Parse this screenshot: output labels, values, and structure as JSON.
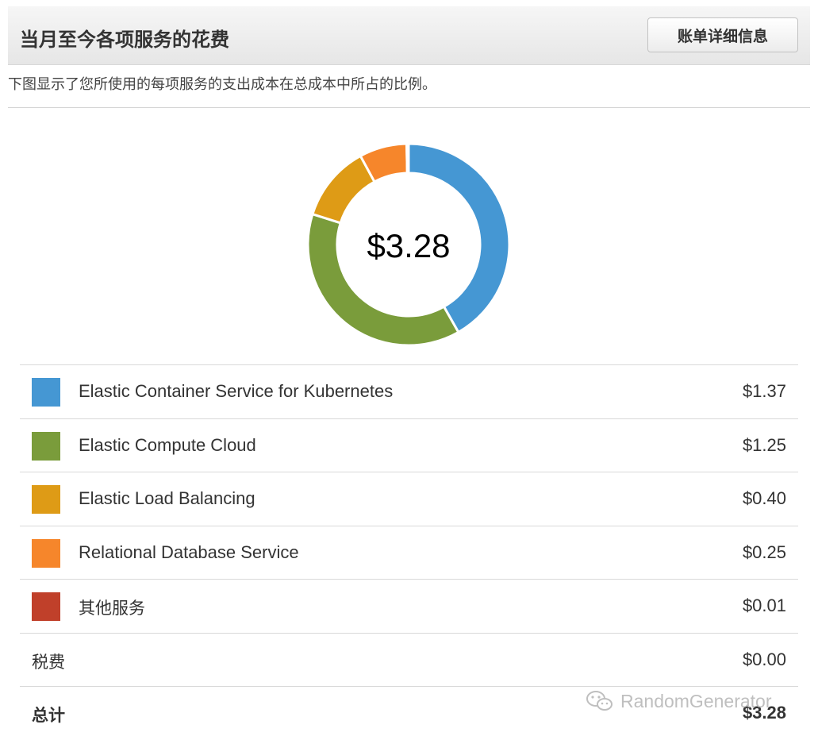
{
  "header": {
    "title": "当月至今各项服务的花费",
    "detail_button": "账单详细信息"
  },
  "subtitle": "下图显示了您所使用的每项服务的支出成本在总成本中所占的比例。",
  "donut": {
    "total_label": "$3.28"
  },
  "services": [
    {
      "name": "Elastic Container Service for Kubernetes",
      "amount": "$1.37",
      "value": 1.37,
      "color": "#4597d3"
    },
    {
      "name": "Elastic Compute Cloud",
      "amount": "$1.25",
      "value": 1.25,
      "color": "#7a9c3b"
    },
    {
      "name": "Elastic Load Balancing",
      "amount": "$0.40",
      "value": 0.4,
      "color": "#de9b16"
    },
    {
      "name": "Relational Database Service",
      "amount": "$0.25",
      "value": 0.25,
      "color": "#f6862b"
    },
    {
      "name": "其他服务",
      "amount": "$0.01",
      "value": 0.01,
      "color": "#c0402a"
    }
  ],
  "tax": {
    "label": "税费",
    "amount": "$0.00"
  },
  "total": {
    "label": "总计",
    "amount": "$3.28"
  },
  "watermark": {
    "text": "RandomGenerator",
    "icon": "wechat-icon"
  }
}
